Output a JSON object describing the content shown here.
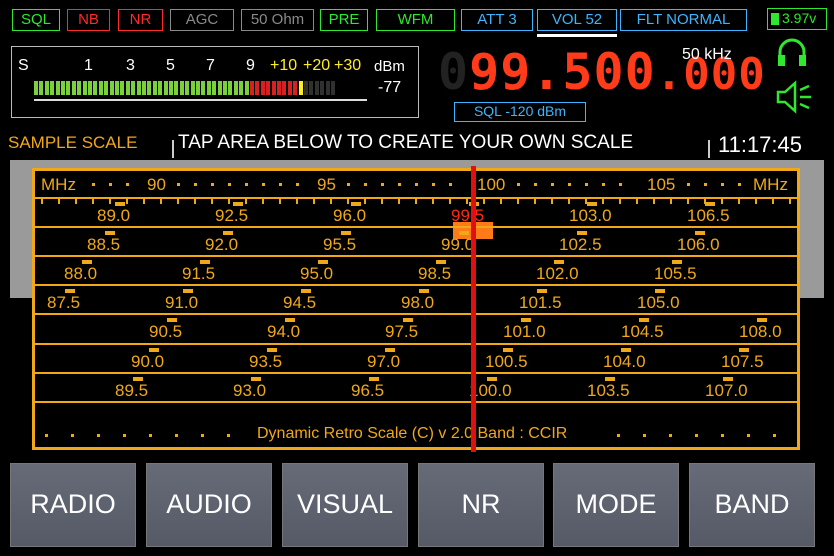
{
  "status_tags": [
    {
      "label": "SQL",
      "color": "green"
    },
    {
      "label": "NB",
      "color": "red"
    },
    {
      "label": "NR",
      "color": "red"
    },
    {
      "label": "AGC",
      "color": "gray"
    },
    {
      "label": "50 Ohm",
      "color": "gray"
    },
    {
      "label": "PRE",
      "color": "green"
    },
    {
      "label": "WFM",
      "color": "green"
    },
    {
      "label": "ATT 3",
      "color": "blue"
    },
    {
      "label": "VOL 52",
      "color": "blue"
    },
    {
      "label": "FLT NORMAL",
      "color": "blue"
    }
  ],
  "battery": "3.97v",
  "smeter": {
    "scale": [
      "S",
      "1",
      "3",
      "5",
      "7",
      "9",
      "+10",
      "+20",
      "+30"
    ],
    "unit": "dBm",
    "value": "-77",
    "level_fraction": 0.9
  },
  "frequency": {
    "leading": "0",
    "main": "99.500",
    "tail": ".000",
    "step": "50 kHz",
    "sql": "SQL -120 dBm"
  },
  "caption": {
    "sample_scale": "SAMPLE SCALE",
    "tap": "TAP AREA BELOW TO CREATE YOUR OWN SCALE",
    "clock": "11:17:45"
  },
  "dial": {
    "top_unit": "MHz",
    "top_labels": [
      "90",
      "95",
      "100",
      "105"
    ],
    "rows": [
      [
        "89.0",
        "92.5",
        "96.0",
        "99.5",
        "103.0",
        "106.5"
      ],
      [
        "88.5",
        "92.0",
        "95.5",
        "99.0",
        "102.5",
        "106.0"
      ],
      [
        "88.0",
        "91.5",
        "95.0",
        "98.5",
        "102.0",
        "105.5"
      ],
      [
        "87.5",
        "91.0",
        "94.5",
        "98.0",
        "101.5",
        "105.0"
      ],
      [
        "90.5",
        "94.0",
        "97.5",
        "101.0",
        "104.5",
        "108.0"
      ],
      [
        "90.0",
        "93.5",
        "97.0",
        "100.5",
        "104.0",
        "107.5"
      ],
      [
        "89.5",
        "93.0",
        "96.5",
        "100.0",
        "103.5",
        "107.0"
      ]
    ],
    "footer": "Dynamic Retro Scale (C) v 2.0 Band : CCIR",
    "selected": "99.5"
  },
  "buttons": [
    "RADIO",
    "AUDIO",
    "VISUAL",
    "NR",
    "MODE",
    "BAND"
  ],
  "colors": {
    "accent": "#f0a818",
    "needle": "#e01010",
    "freq": "#ff3b1a",
    "status_green": "#2ee82e",
    "status_blue": "#3fb4ff"
  }
}
